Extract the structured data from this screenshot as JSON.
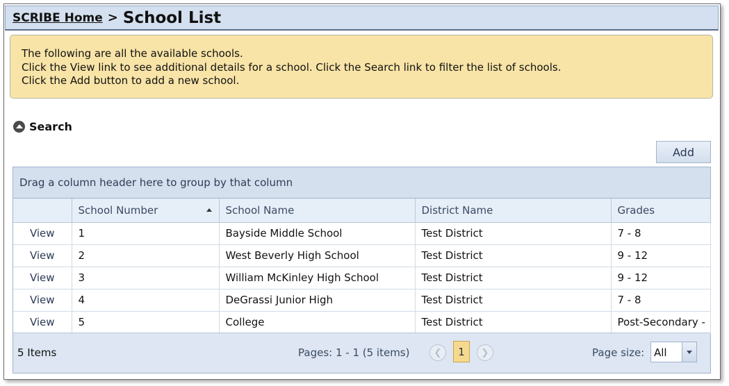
{
  "breadcrumb": {
    "home_link": "SCRIBE Home",
    "separator": ">",
    "title": "School List"
  },
  "info": {
    "line1": "The following are all the available schools.",
    "line2": "Click the View link to see additional details for a school. Click the Search link to filter the list of schools.",
    "line3": "Click the Add button to add a new school."
  },
  "search": {
    "label": "Search",
    "icon": "collapse-up-icon"
  },
  "add_button": {
    "label": "Add"
  },
  "grid": {
    "group_hint": "Drag a column header here to group by that column",
    "columns": [
      {
        "label": ""
      },
      {
        "label": "School Number",
        "sorted": "ascending"
      },
      {
        "label": "School Name"
      },
      {
        "label": "District Name"
      },
      {
        "label": "Grades"
      }
    ],
    "rows": [
      {
        "action": "View",
        "number": "1",
        "name": "Bayside Middle School",
        "district": "Test District",
        "grades": "7 - 8"
      },
      {
        "action": "View",
        "number": "2",
        "name": "West Beverly High School",
        "district": "Test District",
        "grades": "9 - 12"
      },
      {
        "action": "View",
        "number": "3",
        "name": "William McKinley High School",
        "district": "Test District",
        "grades": "9 - 12"
      },
      {
        "action": "View",
        "number": "4",
        "name": "DeGrassi Junior High",
        "district": "Test District",
        "grades": "7 - 8"
      },
      {
        "action": "View",
        "number": "5",
        "name": "College",
        "district": "Test District",
        "grades": "Post-Secondary -"
      }
    ]
  },
  "pager": {
    "items_count": "5 Items",
    "pages_text": "Pages: 1 - 1 (5 items)",
    "current_page": "1",
    "page_size_label": "Page size:",
    "page_size_value": "All"
  },
  "colors": {
    "title_bar": "#d4e0ef",
    "info_background": "#f8e4a7",
    "grid_header": "#e6eef8",
    "current_page_highlight": "#f5d98f"
  }
}
